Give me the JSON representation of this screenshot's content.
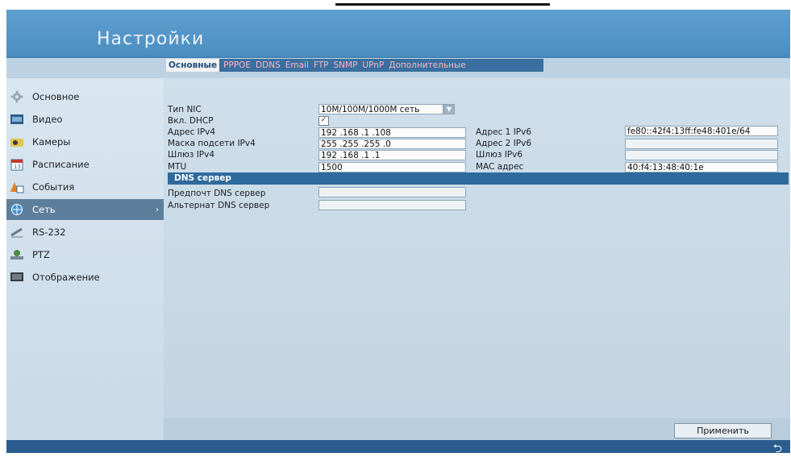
{
  "window": {
    "title": "Настройки"
  },
  "tabs": [
    {
      "label": "Основные",
      "active": true
    },
    {
      "label": "PPPOE",
      "active": false
    },
    {
      "label": "DDNS",
      "active": false
    },
    {
      "label": "Email",
      "active": false
    },
    {
      "label": "FTP",
      "active": false
    },
    {
      "label": "SNMP",
      "active": false
    },
    {
      "label": "UPnP",
      "active": false
    },
    {
      "label": "Дополнительные",
      "active": false
    }
  ],
  "sidebar": {
    "items": [
      {
        "label": "Основное",
        "icon": "gear-icon",
        "selected": false
      },
      {
        "label": "Видео",
        "icon": "film-icon",
        "selected": false
      },
      {
        "label": "Камеры",
        "icon": "camera-icon",
        "selected": false
      },
      {
        "label": "Расписание",
        "icon": "calendar-icon",
        "selected": false
      },
      {
        "label": "События",
        "icon": "alarm-icon",
        "selected": false
      },
      {
        "label": "Сеть",
        "icon": "network-globe-icon",
        "selected": true
      },
      {
        "label": "RS-232",
        "icon": "serial-icon",
        "selected": false
      },
      {
        "label": "PTZ",
        "icon": "ptz-icon",
        "selected": false
      },
      {
        "label": "Отображение",
        "icon": "monitor-icon",
        "selected": false
      }
    ]
  },
  "form": {
    "nic_type": {
      "label": "Тип NIC",
      "value": "10M/100M/1000M сеть"
    },
    "dhcp": {
      "label": "Вкл. DHCP",
      "checked": true
    },
    "ipv4": {
      "label": "Адрес IPv4",
      "value": "192 .168 .1    .108"
    },
    "mask": {
      "label": "Маска подсети IPv4",
      "value": "255 .255 .255 .0"
    },
    "gateway": {
      "label": "Шлюз IPv4",
      "value": "192 .168 .1    .1"
    },
    "mtu": {
      "label": "MTU",
      "value": "1500"
    },
    "ipv6_1": {
      "label": "Адрес 1 IPv6",
      "value": "fe80::42f4:13ff:fe48:401e/64"
    },
    "ipv6_2": {
      "label": "Адрес 2 IPv6",
      "value": ""
    },
    "ipv6_gw": {
      "label": "Шлюз IPv6",
      "value": ""
    },
    "mac": {
      "label": "MAC адрес",
      "value": "40:f4:13:48:40:1e"
    }
  },
  "dns": {
    "section_title": "DNS сервер",
    "preferred": {
      "label": "Предпочт DNS сервер",
      "value": ""
    },
    "alternate": {
      "label": "Альтернат DNS сервер",
      "value": ""
    }
  },
  "actions": {
    "apply_label": "Применить"
  },
  "footer": {
    "back_icon": "back-arrow-icon",
    "back_glyph": "⮌"
  },
  "colors": {
    "accent": "#2e6a9c",
    "selected_nav": "#5d7f9b",
    "inactive_tab": "#ffb3c6"
  }
}
